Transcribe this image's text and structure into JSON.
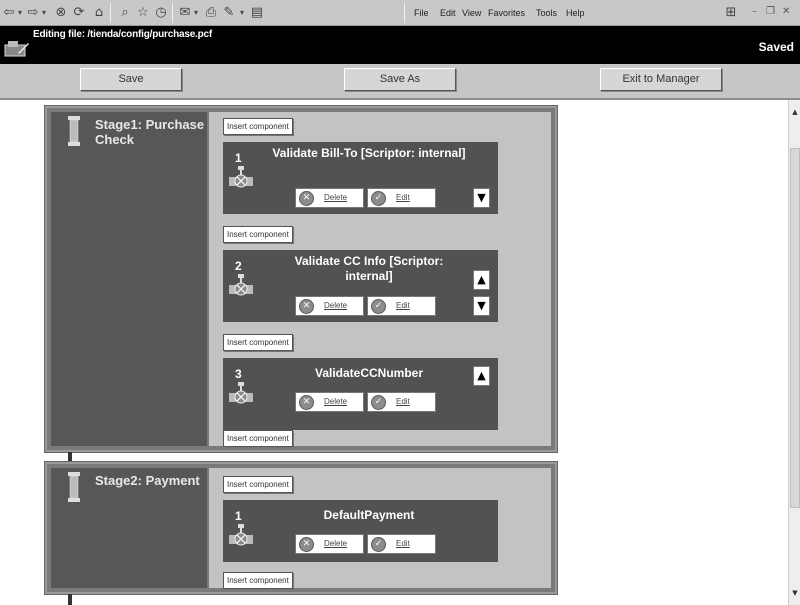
{
  "browser": {
    "menu": [
      "File",
      "Edit",
      "View",
      "Favorites",
      "Tools",
      "Help"
    ]
  },
  "titlebar": {
    "title": "Editing file: /tienda/config/purchase.pcf",
    "status": "Saved"
  },
  "actions": {
    "save": "Save",
    "save_as": "Save As",
    "exit": "Exit to Manager"
  },
  "insert_label": "Insert component",
  "stages": [
    {
      "label": "Stage1: Purchase Check",
      "components": [
        {
          "index": "1",
          "name": "Validate Bill-To [Scriptor: internal]",
          "delete": "Delete",
          "edit": "Edit"
        },
        {
          "index": "2",
          "name": "Validate CC Info [Scriptor: internal]",
          "delete": "Delete",
          "edit": "Edit"
        },
        {
          "index": "3",
          "name": "ValidateCCNumber",
          "delete": "Delete",
          "edit": "Edit"
        }
      ]
    },
    {
      "label": "Stage2: Payment",
      "components": [
        {
          "index": "1",
          "name": "DefaultPayment",
          "delete": "Delete",
          "edit": "Edit"
        }
      ]
    }
  ]
}
